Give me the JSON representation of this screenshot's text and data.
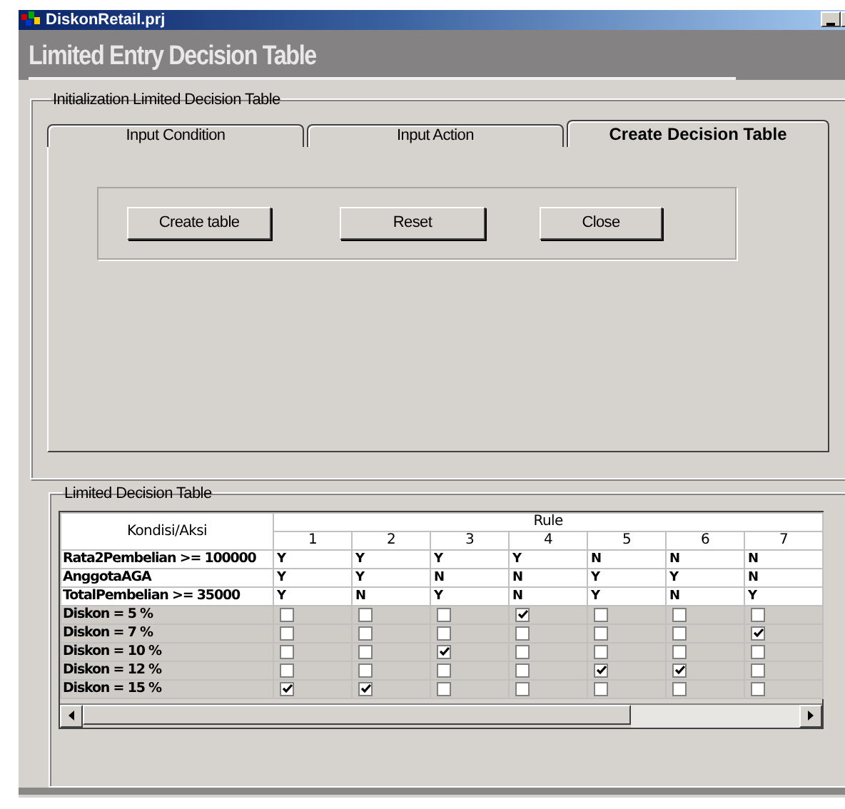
{
  "window": {
    "title": "DiskonRetail.prj"
  },
  "header": {
    "title": "Limited Entry Decision Table"
  },
  "init_group": {
    "title": "Initialization Limited Decision Table",
    "tabs": [
      {
        "label": "Input Condition",
        "selected": false
      },
      {
        "label": "Input Action",
        "selected": false
      },
      {
        "label": "Create Decision Table",
        "selected": true
      }
    ],
    "buttons": [
      "Create table",
      "Reset",
      "Close"
    ]
  },
  "table_group": {
    "title": "Limited Decision Table",
    "table": {
      "corner": "Kondisi/Aksi",
      "group_header": "Rule",
      "columns": [
        "1",
        "2",
        "3",
        "4",
        "5",
        "6",
        "7"
      ],
      "rows": [
        {
          "kind": "condition",
          "label": "Rata2Pembelian >= 100000",
          "values": [
            "Y",
            "Y",
            "Y",
            "Y",
            "N",
            "N",
            "N"
          ]
        },
        {
          "kind": "condition",
          "label": "AnggotaAGA",
          "values": [
            "Y",
            "Y",
            "N",
            "N",
            "Y",
            "Y",
            "N"
          ]
        },
        {
          "kind": "condition",
          "label": "TotalPembelian >= 35000",
          "values": [
            "Y",
            "N",
            "Y",
            "N",
            "Y",
            "N",
            "Y"
          ]
        },
        {
          "kind": "action",
          "label": "Diskon = 5 %",
          "checks": [
            false,
            false,
            false,
            true,
            false,
            false,
            false
          ]
        },
        {
          "kind": "action",
          "label": "Diskon = 7 %",
          "checks": [
            false,
            false,
            false,
            false,
            false,
            false,
            true
          ]
        },
        {
          "kind": "action",
          "label": "Diskon = 10 %",
          "checks": [
            false,
            false,
            true,
            false,
            false,
            false,
            false
          ]
        },
        {
          "kind": "action",
          "label": "Diskon = 12 %",
          "checks": [
            false,
            false,
            false,
            false,
            true,
            true,
            false
          ]
        },
        {
          "kind": "action",
          "label": "Diskon = 15 %",
          "checks": [
            true,
            true,
            false,
            false,
            false,
            false,
            false
          ]
        }
      ]
    }
  }
}
